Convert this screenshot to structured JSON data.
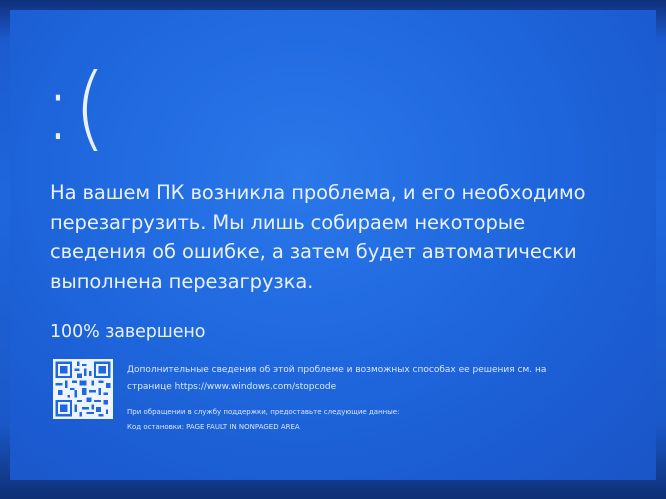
{
  "bsod": {
    "face": ":(",
    "message": "На вашем ПК возникла проблема, и его необходимо\nперезагрузить. Мы лишь собираем некоторые\nсведения об ошибке, а затем будет автоматически\nвыполнена перезагрузка.",
    "progress": "100% завершено",
    "more_info": "Дополнительные сведения об этой проблеме и возможных способах ее решения см. на\nстранице https://www.windows.com/stopcode",
    "support_line": "При обращении в службу поддержки, предоставьте следующие данные:",
    "stop_code_line": "Код остановки: PAGE FAULT IN NONPAGED AREA",
    "qr_icon": "qr-code-icon"
  },
  "colors": {
    "background": "#1f67dd",
    "text": "#e9f1ff"
  }
}
